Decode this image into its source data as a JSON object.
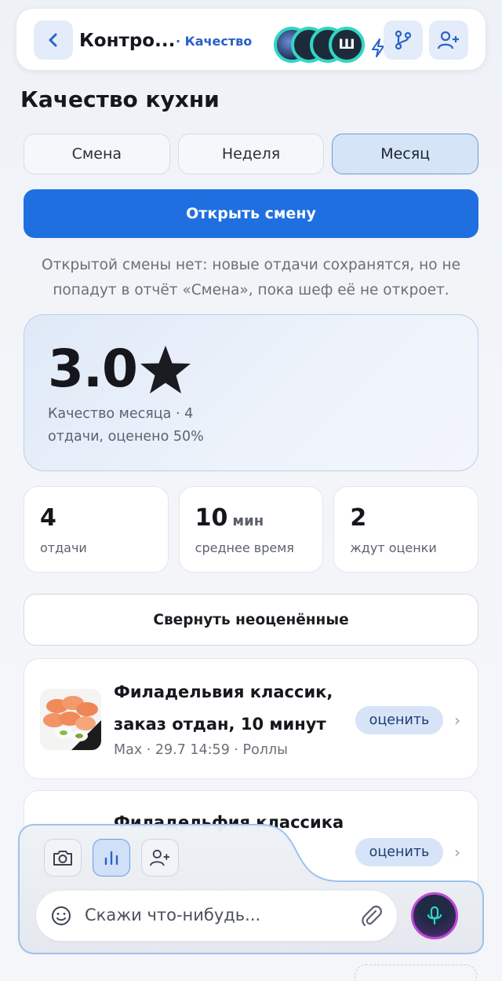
{
  "header": {
    "back_icon": "chevron-left-icon",
    "title": "Контро...",
    "subtitle": "· Качество",
    "avatars": [
      "",
      "",
      "",
      "Ш"
    ],
    "icons": [
      "lightning-icon",
      "branch-icon",
      "add-user-icon"
    ]
  },
  "page": {
    "title": "Качество кухни"
  },
  "tabs": [
    {
      "label": "Смена",
      "active": false
    },
    {
      "label": "Неделя",
      "active": false
    },
    {
      "label": "Месяц",
      "active": true
    }
  ],
  "open_shift": {
    "label": "Открыть смену"
  },
  "notice": "Открытой смены нет: новые отдачи сохранятся, но не попадут в отчёт «Смена», пока шеф её не откроет.",
  "rating": {
    "value": "3.0",
    "star": "★",
    "caption": "Качество месяца · 4 отдачи, оценено 50%"
  },
  "stats": [
    {
      "number": "4",
      "unit": "",
      "label": "отдачи"
    },
    {
      "number": "10",
      "unit": "мин",
      "label": "среднее время"
    },
    {
      "number": "2",
      "unit": "",
      "label": "ждут оценки"
    }
  ],
  "collapse_button": "Свернуть неоценённые",
  "items": [
    {
      "title": "Филадельвия классик, заказ отдан, 10 минут",
      "meta": "Max · 29.7 14:59 · Роллы",
      "rate_label": "оценить"
    },
    {
      "title": "Филадельфия классика",
      "meta": "",
      "rate_label": "оценить"
    }
  ],
  "composer": {
    "tools": [
      "camera-icon",
      "bar-chart-icon",
      "add-user-icon"
    ],
    "placeholder": "Скажи что-нибудь...",
    "icons": [
      "smile-icon",
      "paperclip-icon",
      "microphone-icon"
    ]
  },
  "colors": {
    "accent": "#1f6fe0",
    "accent_light": "#d7e4f7",
    "avatar_ring": "#31d6c4",
    "mic_ring": "#c04ad8"
  }
}
